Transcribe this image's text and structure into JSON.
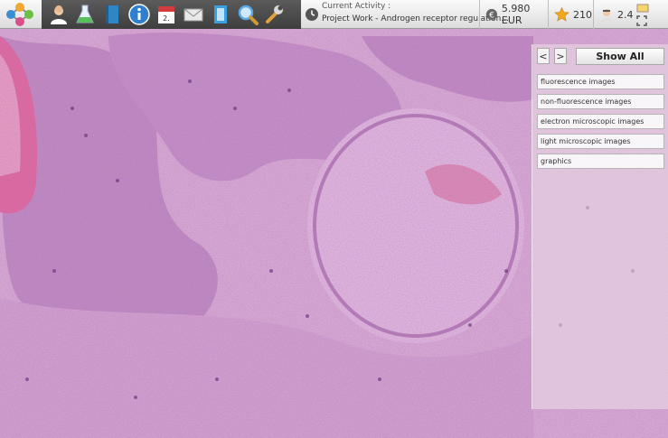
{
  "toolbar": {
    "icons": [
      "molecule-logo-icon",
      "doctor-icon",
      "lab-flask-icon",
      "book-icon",
      "info-icon",
      "calendar-icon",
      "mail-icon",
      "document-icon",
      "magnifier-icon",
      "wrench-icon"
    ],
    "calendar_day": "2.",
    "current_activity_label": "Current Activity :",
    "current_activity_value": "Project Work - Androgen receptor regulation...",
    "money": "5.980 EUR",
    "stars": "210",
    "rating": "2.4"
  },
  "panel": {
    "prev_label": "<",
    "next_label": ">",
    "show_all_label": "Show All",
    "filters": [
      "fluorescence images",
      "non-fluorescence images",
      "electron microscopic images",
      "light microscopic images",
      "graphics"
    ]
  },
  "colors": {
    "tissue_base": "#e6b8dc",
    "nuclei": "#5b2d7a",
    "keratin": "#e0507a",
    "toolbar_dark": "#4a4a4a"
  }
}
